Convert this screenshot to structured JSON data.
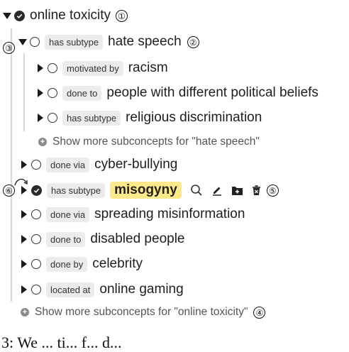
{
  "root": {
    "label": "online toxicity",
    "marker": "①"
  },
  "hate": {
    "relation": "has subtype",
    "label": "hate speech",
    "marker": "②",
    "side_marker": "③"
  },
  "hate_children": [
    {
      "relation": "motivated by",
      "label": "racism"
    },
    {
      "relation": "done to",
      "label": "people with different political beliefs"
    },
    {
      "relation": "has subtype",
      "label": "religious discrimination"
    }
  ],
  "hate_more": "Show more subconcepts for \"hate speech\"",
  "children": [
    {
      "relation": "done via",
      "label": "cyber-bullying"
    },
    {
      "relation": "has subtype",
      "label": "misogyny"
    },
    {
      "relation": "done via",
      "label": "spreading misinformation"
    },
    {
      "relation": "done to",
      "label": "disabled people"
    },
    {
      "relation": "done by",
      "label": "celebrity"
    },
    {
      "relation": "located at",
      "label": "online gaming"
    }
  ],
  "misogyny_markers": {
    "left": "⑥",
    "right": "⑤"
  },
  "root_more": "Show more subconcepts for \"online toxicity\"",
  "root_more_marker": "④",
  "caption": "3: We ... ti... f... d..."
}
